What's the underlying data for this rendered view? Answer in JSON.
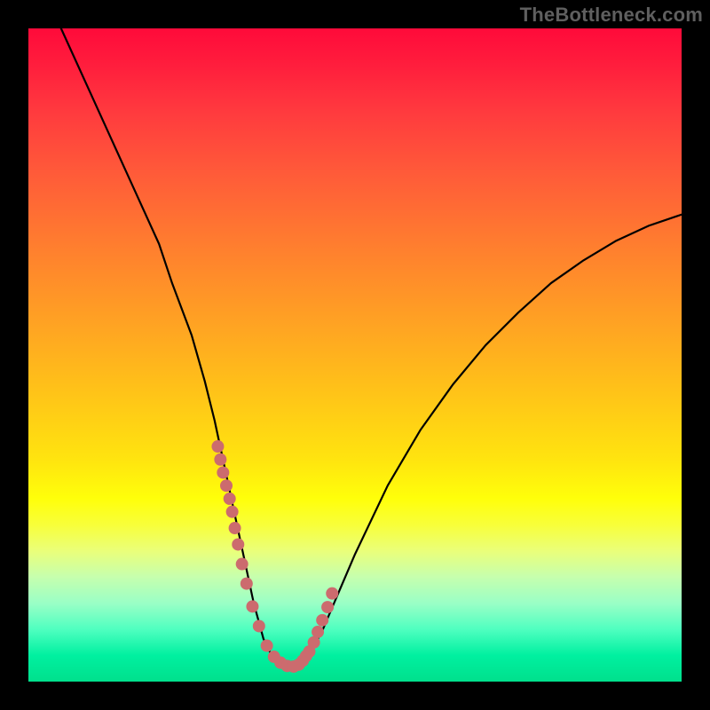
{
  "watermark": "TheBottleneck.com",
  "chart_data": {
    "type": "line",
    "title": "",
    "xlabel": "",
    "ylabel": "",
    "xlim": [
      0,
      100
    ],
    "ylim": [
      0,
      100
    ],
    "series": [
      {
        "name": "bottleneck-curve",
        "x": [
          5,
          10,
          15,
          20,
          22,
          25,
          27,
          28.5,
          30,
          31.5,
          33,
          34.5,
          36,
          37,
          38,
          39,
          40,
          41.5,
          43,
          45,
          47,
          50,
          55,
          60,
          65,
          70,
          75,
          80,
          85,
          90,
          95,
          100
        ],
        "values": [
          100,
          89,
          78,
          67,
          61,
          53,
          46,
          40,
          33,
          26,
          19,
          12,
          6.5,
          4.5,
          3.2,
          2.4,
          2.2,
          2.6,
          4.2,
          7.8,
          12.5,
          19.5,
          30,
          38.5,
          45.5,
          51.5,
          56.5,
          61,
          64.5,
          67.5,
          69.8,
          71.5
        ]
      }
    ],
    "markers": {
      "name": "highlight-dots",
      "x": [
        29.0,
        29.4,
        29.8,
        30.3,
        30.8,
        31.2,
        31.6,
        32.1,
        32.7,
        33.4,
        34.3,
        35.3,
        36.5,
        37.6,
        38.6,
        39.6,
        40.6,
        41.4,
        42.0,
        42.5,
        43.0,
        43.7,
        44.3,
        45.0,
        45.8,
        46.5
      ],
      "values": [
        36.0,
        34.0,
        32.0,
        30.0,
        28.0,
        26.0,
        23.5,
        21.0,
        18.0,
        15.0,
        11.5,
        8.5,
        5.5,
        3.8,
        2.9,
        2.4,
        2.3,
        2.6,
        3.2,
        3.9,
        4.6,
        6.0,
        7.6,
        9.4,
        11.4,
        13.5
      ]
    }
  }
}
